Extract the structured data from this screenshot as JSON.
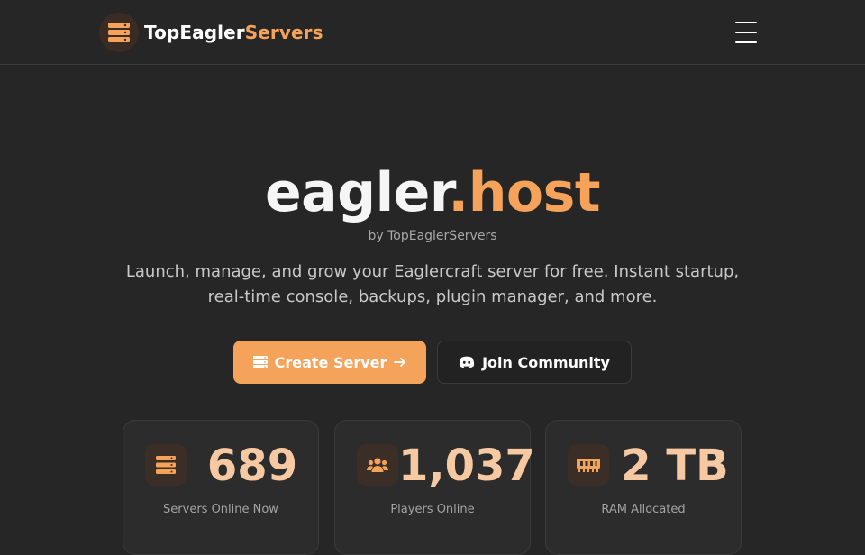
{
  "navbar": {
    "brand_primary": "TopEagler",
    "brand_accent": "Servers",
    "brand_icon": "server-icon",
    "menu_icon": "hamburger-menu-icon"
  },
  "hero": {
    "title_main": "eagler",
    "title_accent": ".host",
    "subtitle": "by TopEaglerServers",
    "description": "Launch, manage, and grow your Eaglercraft server for free. Instant startup, real-time console, backups, plugin manager, and more."
  },
  "actions": {
    "create_label": "Create Server",
    "create_icon": "server-icon",
    "create_arrow_icon": "arrow-right-icon",
    "join_label": "Join Community",
    "join_icon": "discord-icon"
  },
  "stats": [
    {
      "value": "689",
      "label": "Servers Online Now",
      "icon": "server-icon"
    },
    {
      "value": "1,037",
      "label": "Players Online",
      "icon": "users-icon"
    },
    {
      "value": "2 TB",
      "label": "RAM Allocated",
      "icon": "memory-icon"
    }
  ],
  "colors": {
    "background": "#262626",
    "accent": "#f5a25a",
    "stat_value": "#f7c9a3",
    "card": "#2c2c2c"
  }
}
